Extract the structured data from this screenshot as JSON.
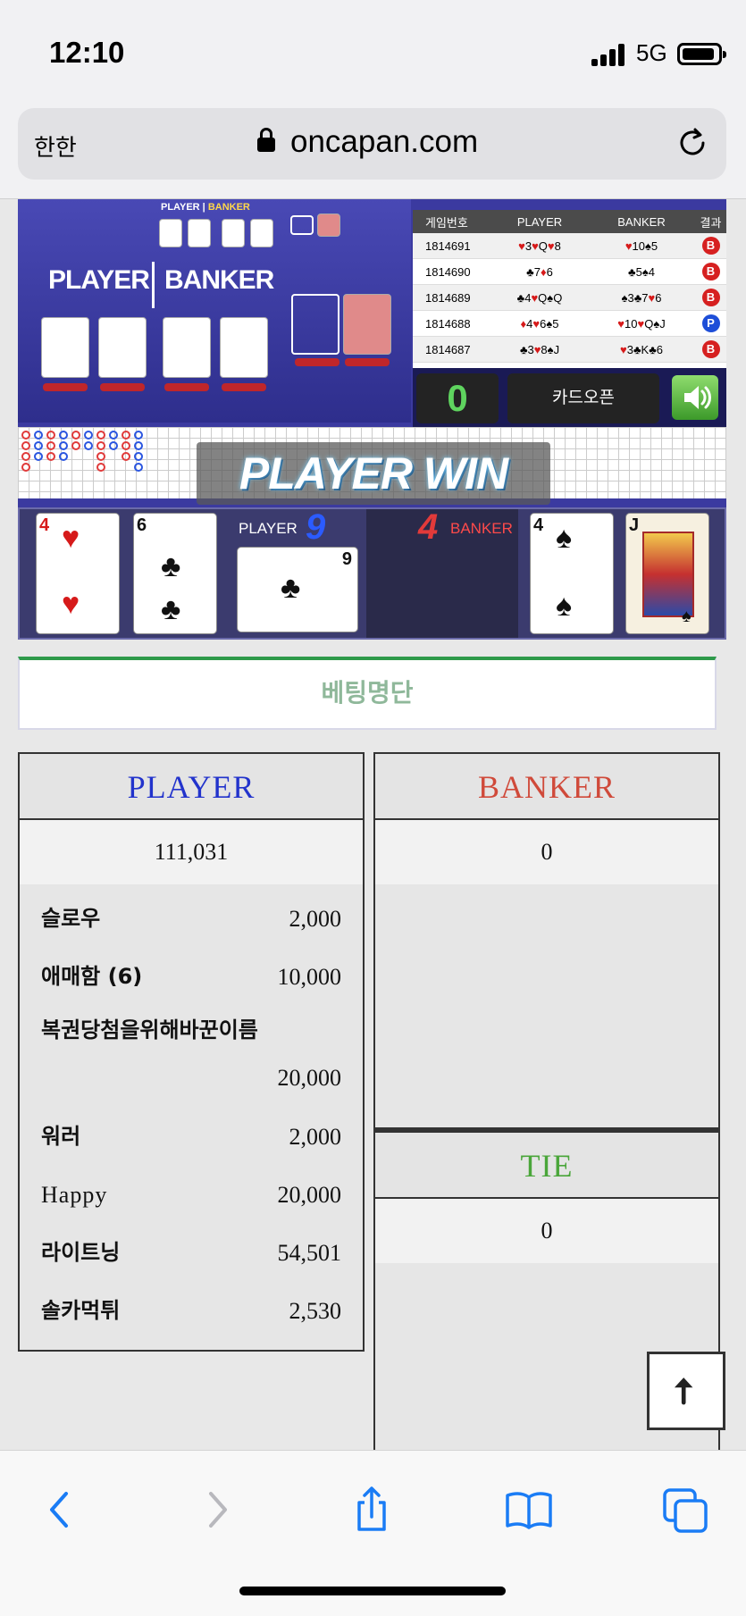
{
  "status": {
    "time": "12:10",
    "network": "5G"
  },
  "browser": {
    "aa_label": "한한",
    "url": "oncapan.com"
  },
  "game": {
    "table_labels": {
      "player": "PLAYER",
      "banker": "BANKER",
      "mini_player": "PLAYER",
      "mini_banker": "BANKER"
    },
    "results_header": {
      "id": "게임번호",
      "player": "PLAYER",
      "banker": "BANKER",
      "result": "결과"
    },
    "results": [
      {
        "id": "1814691",
        "player": "♥3♥Q♥8",
        "banker": "♥10♠5",
        "result": "B"
      },
      {
        "id": "1814690",
        "player": "♣7♦6",
        "banker": "♣5♠4",
        "result": "B"
      },
      {
        "id": "1814689",
        "player": "♣4♥Q♠Q",
        "banker": "♠3♣7♥6",
        "result": "B"
      },
      {
        "id": "1814688",
        "player": "♦4♥6♠5",
        "banker": "♥10♥Q♠J",
        "result": "P"
      },
      {
        "id": "1814687",
        "player": "♣3♥8♠J",
        "banker": "♥3♣K♣6",
        "result": "B"
      }
    ],
    "counter": "0",
    "card_open_label": "카드오픈",
    "win_banner": "PLAYER WIN",
    "player_score_label": "PLAYER",
    "player_score": "9",
    "banker_score_label": "BANKER",
    "banker_score": "4",
    "player_cards": [
      {
        "rank": "4",
        "suit": "♥",
        "color": "red"
      },
      {
        "rank": "6",
        "suit": "♣",
        "color": "black"
      },
      {
        "rank": "9",
        "suit": "♣",
        "color": "black"
      }
    ],
    "banker_cards": [
      {
        "rank": "4",
        "suit": "♠",
        "color": "black"
      },
      {
        "rank": "J",
        "suit": "♠",
        "color": "black"
      }
    ]
  },
  "betting": {
    "title": "베팅명단",
    "player": {
      "label": "PLAYER",
      "color": "#2233cc",
      "total": "111,031",
      "bets": [
        {
          "name": "슬로우",
          "amount": "2,000"
        },
        {
          "name": "애매함 (6)",
          "amount": "10,000"
        },
        {
          "name": "복권당첨을위해바꾼이름",
          "amount": "20,000"
        },
        {
          "name": "워러",
          "amount": "2,000"
        },
        {
          "name": "Happy",
          "amount": "20,000"
        },
        {
          "name": "라이트닝",
          "amount": "54,501"
        },
        {
          "name": "솔카먹튀",
          "amount": "2,530"
        }
      ]
    },
    "banker": {
      "label": "BANKER",
      "color": "#d04a3a",
      "total": "0"
    },
    "tie": {
      "label": "TIE",
      "color": "#4aa63a",
      "total": "0"
    }
  },
  "toolbar": {
    "icons": [
      "back-icon",
      "forward-icon",
      "share-icon",
      "bookmarks-icon",
      "tabs-icon"
    ],
    "accent": "#1a7cf5"
  }
}
